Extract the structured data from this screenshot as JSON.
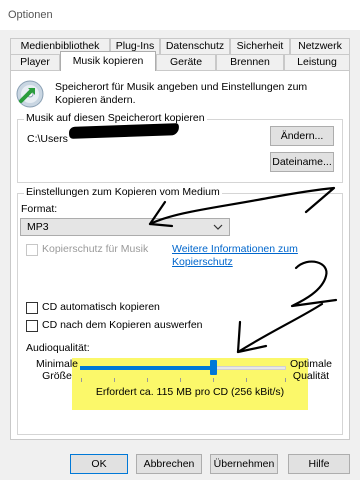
{
  "window": {
    "title": "Optionen"
  },
  "tabs_row1": [
    "Medienbibliothek",
    "Plug-Ins",
    "Datenschutz",
    "Sicherheit",
    "Netzwerk"
  ],
  "tabs_row2": [
    "Player",
    "Musik kopieren",
    "Geräte",
    "Brennen",
    "Leistung"
  ],
  "active_tab": "Musik kopieren",
  "intro_text": "Speicherort für Musik angeben und Einstellungen zum Kopieren ändern.",
  "location_group": {
    "title": "Musik auf diesen Speicherort kopieren",
    "path": "C:\\Users",
    "change_button": "Ändern...",
    "filename_button": "Dateiname..."
  },
  "settings_group": {
    "title": "Einstellungen zum Kopieren vom Medium",
    "format_label": "Format:",
    "format_value": "MP3",
    "copy_protection_label": "Kopierschutz für Musik",
    "copy_protection_checked": false,
    "copy_protection_enabled": false,
    "more_info_link": "Weitere Informationen zum Kopierschutz",
    "auto_copy_label": "CD automatisch kopieren",
    "auto_copy_checked": false,
    "eject_label": "CD nach dem Kopieren auswerfen",
    "eject_checked": false,
    "quality_label": "Audioqualität:",
    "min_label": "Minimale Größe",
    "max_label": "Optimale Qualität",
    "quality_fraction": 0.63,
    "requirement_text": "Erfordert ca. 115 MB pro CD (256 kBit/s)"
  },
  "buttons": {
    "ok": "OK",
    "cancel": "Abbrechen",
    "apply": "Übernehmen",
    "help": "Hilfe"
  },
  "colors": {
    "accent": "#0078d7",
    "link": "#0066cc",
    "highlight": "#fbf86a"
  }
}
